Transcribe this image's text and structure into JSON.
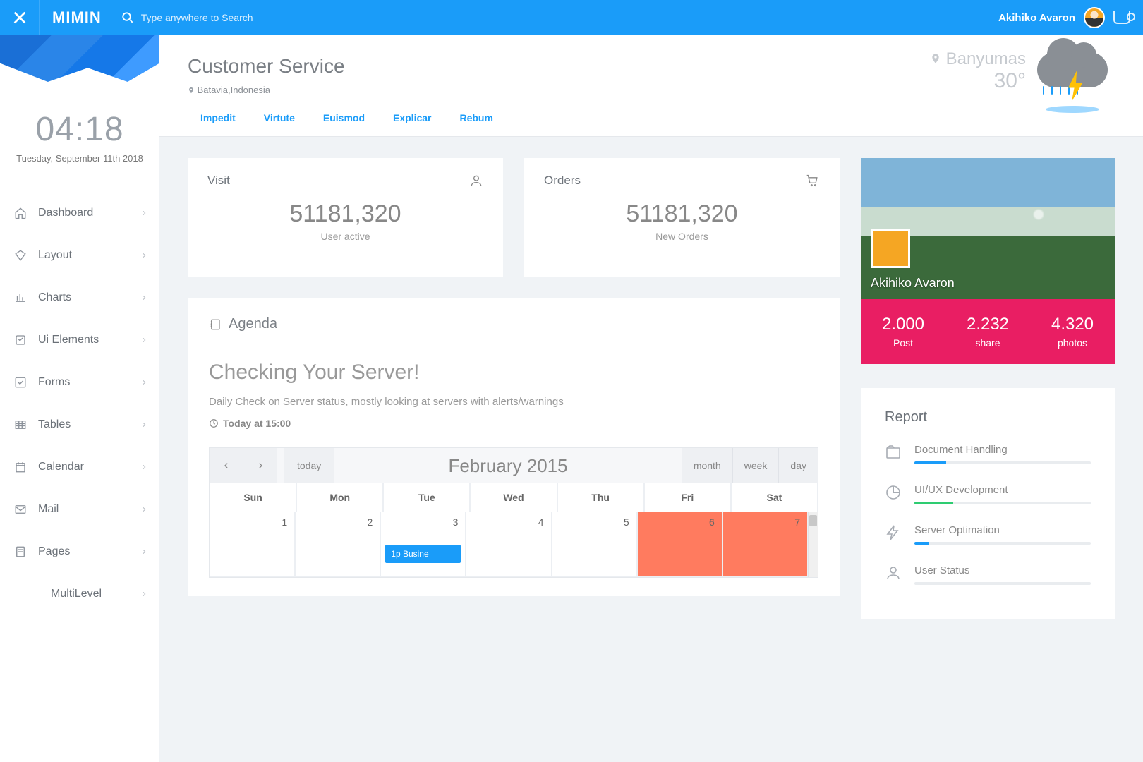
{
  "brand": "MIMIN",
  "search": {
    "placeholder": "Type anywhere to Search"
  },
  "user": {
    "name": "Akihiko Avaron"
  },
  "clock": {
    "time": "04:18",
    "date": "Tuesday, September 11th 2018"
  },
  "nav": [
    {
      "label": "Dashboard",
      "icon": "home"
    },
    {
      "label": "Layout",
      "icon": "diamond"
    },
    {
      "label": "Charts",
      "icon": "chart"
    },
    {
      "label": "Ui Elements",
      "icon": "ui"
    },
    {
      "label": "Forms",
      "icon": "check"
    },
    {
      "label": "Tables",
      "icon": "table"
    },
    {
      "label": "Calendar",
      "icon": "calendar"
    },
    {
      "label": "Mail",
      "icon": "mail"
    },
    {
      "label": "Pages",
      "icon": "pages"
    },
    {
      "label": "MultiLevel",
      "icon": "",
      "indent": true
    }
  ],
  "page": {
    "title": "Customer Service",
    "location": "Batavia,Indonesia",
    "tabs": [
      "Impedit",
      "Virtute",
      "Euismod",
      "Explicar",
      "Rebum"
    ]
  },
  "weather": {
    "city": "Banyumas",
    "temp": "30°"
  },
  "stats": {
    "visit": {
      "title": "Visit",
      "value": "51181,320",
      "sub": "User active"
    },
    "orders": {
      "title": "Orders",
      "value": "51181,320",
      "sub": "New Orders"
    }
  },
  "agenda": {
    "label": "Agenda",
    "heading": "Checking Your Server!",
    "desc": "Daily Check on Server status, mostly looking at servers with alerts/warnings",
    "when": "Today at 15:00"
  },
  "calendar": {
    "today_label": "today",
    "title": "February 2015",
    "views": [
      "month",
      "week",
      "day"
    ],
    "days": [
      "Sun",
      "Mon",
      "Tue",
      "Wed",
      "Thu",
      "Fri",
      "Sat"
    ],
    "row1": [
      "1",
      "2",
      "3",
      "4",
      "5",
      "6",
      "7"
    ],
    "event": "1p Busine"
  },
  "profile": {
    "name": "Akihiko Avaron",
    "stats": [
      {
        "n": "2.000",
        "l": "Post"
      },
      {
        "n": "2.232",
        "l": "share"
      },
      {
        "n": "4.320",
        "l": "photos"
      }
    ]
  },
  "report": {
    "title": "Report",
    "items": [
      {
        "label": "Document Handling",
        "color": "#1a9cf9",
        "pct": 18
      },
      {
        "label": "UI/UX Development",
        "color": "#2ecc71",
        "pct": 22
      },
      {
        "label": "Server Optimation",
        "color": "#1a9cf9",
        "pct": 8
      },
      {
        "label": "User Status",
        "color": "#1a9cf9",
        "pct": 0
      }
    ]
  }
}
